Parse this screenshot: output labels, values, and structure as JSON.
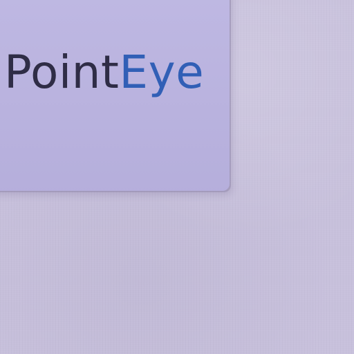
{
  "brand": {
    "part_a": "Point",
    "part_b": "Eye"
  }
}
